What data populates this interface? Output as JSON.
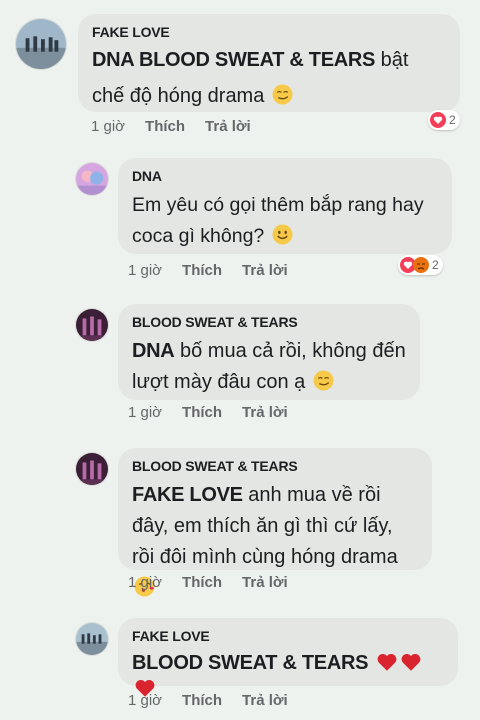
{
  "comments": [
    {
      "author": "FAKE LOVE",
      "mention": "DNA BLOOD SWEAT & TEARS",
      "text": " bật chế độ hóng drama",
      "emoji": "smirk-emoji-icon",
      "time": "1 giờ",
      "like": "Thích",
      "reply": "Trả lời",
      "reaction_count": "2"
    },
    {
      "author": "DNA",
      "text": "Em yêu có gọi thêm bắp rang hay coca gì không?",
      "emoji": "smile-emoji-icon",
      "time": "1 giờ",
      "like": "Thích",
      "reply": "Trả lời",
      "reaction_count": "2"
    },
    {
      "author": "BLOOD SWEAT & TEARS",
      "mention": "DNA",
      "text": " bố mua cả rồi, không đến lượt mày đâu con ạ",
      "emoji": "smirk-emoji-icon",
      "time": "1 giờ",
      "like": "Thích",
      "reply": "Trả lời"
    },
    {
      "author": "BLOOD SWEAT & TEARS",
      "mention": "FAKE LOVE",
      "text": " anh mua về rồi đây, em thích ăn gì thì cứ lấy, rồi đôi mình cùng hóng drama",
      "emoji": "kiss-emoji-icon",
      "time": "1 giờ",
      "like": "Thích",
      "reply": "Trả lời"
    },
    {
      "author": "FAKE LOVE",
      "mention": "BLOOD SWEAT & TEARS",
      "emoji": "red-heart-icon",
      "time": "1 giờ",
      "like": "Thích",
      "reply": "Trả lời"
    }
  ],
  "colors": {
    "page_bg": "#eef2ee",
    "bubble_bg": "#e4e6e3",
    "meta_text": "#65676b",
    "love_reaction": "#f33e58",
    "angry_reaction": "#e9710f"
  }
}
